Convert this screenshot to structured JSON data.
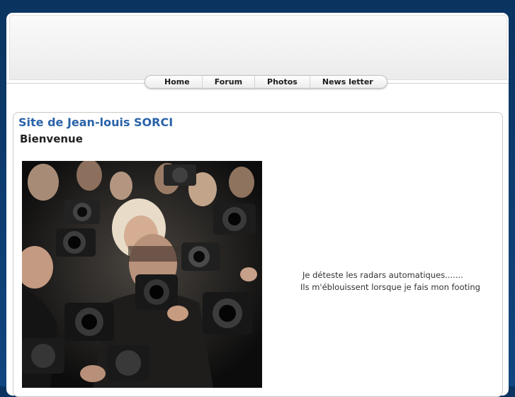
{
  "nav": {
    "items": [
      "Home",
      "Forum",
      "Photos",
      "News letter"
    ]
  },
  "page": {
    "title": "Site de Jean-louis SORCI",
    "subtitle": "Bienvenue"
  },
  "photo": {
    "description_icon": "photographers-crowd-image"
  },
  "caption": {
    "line1": "Je déteste les radars automatiques.......",
    "line2": "Ils m'éblouissent lorsque je fais mon footing"
  },
  "colors": {
    "background": "#0d3b6e",
    "title": "#2a63a8"
  }
}
